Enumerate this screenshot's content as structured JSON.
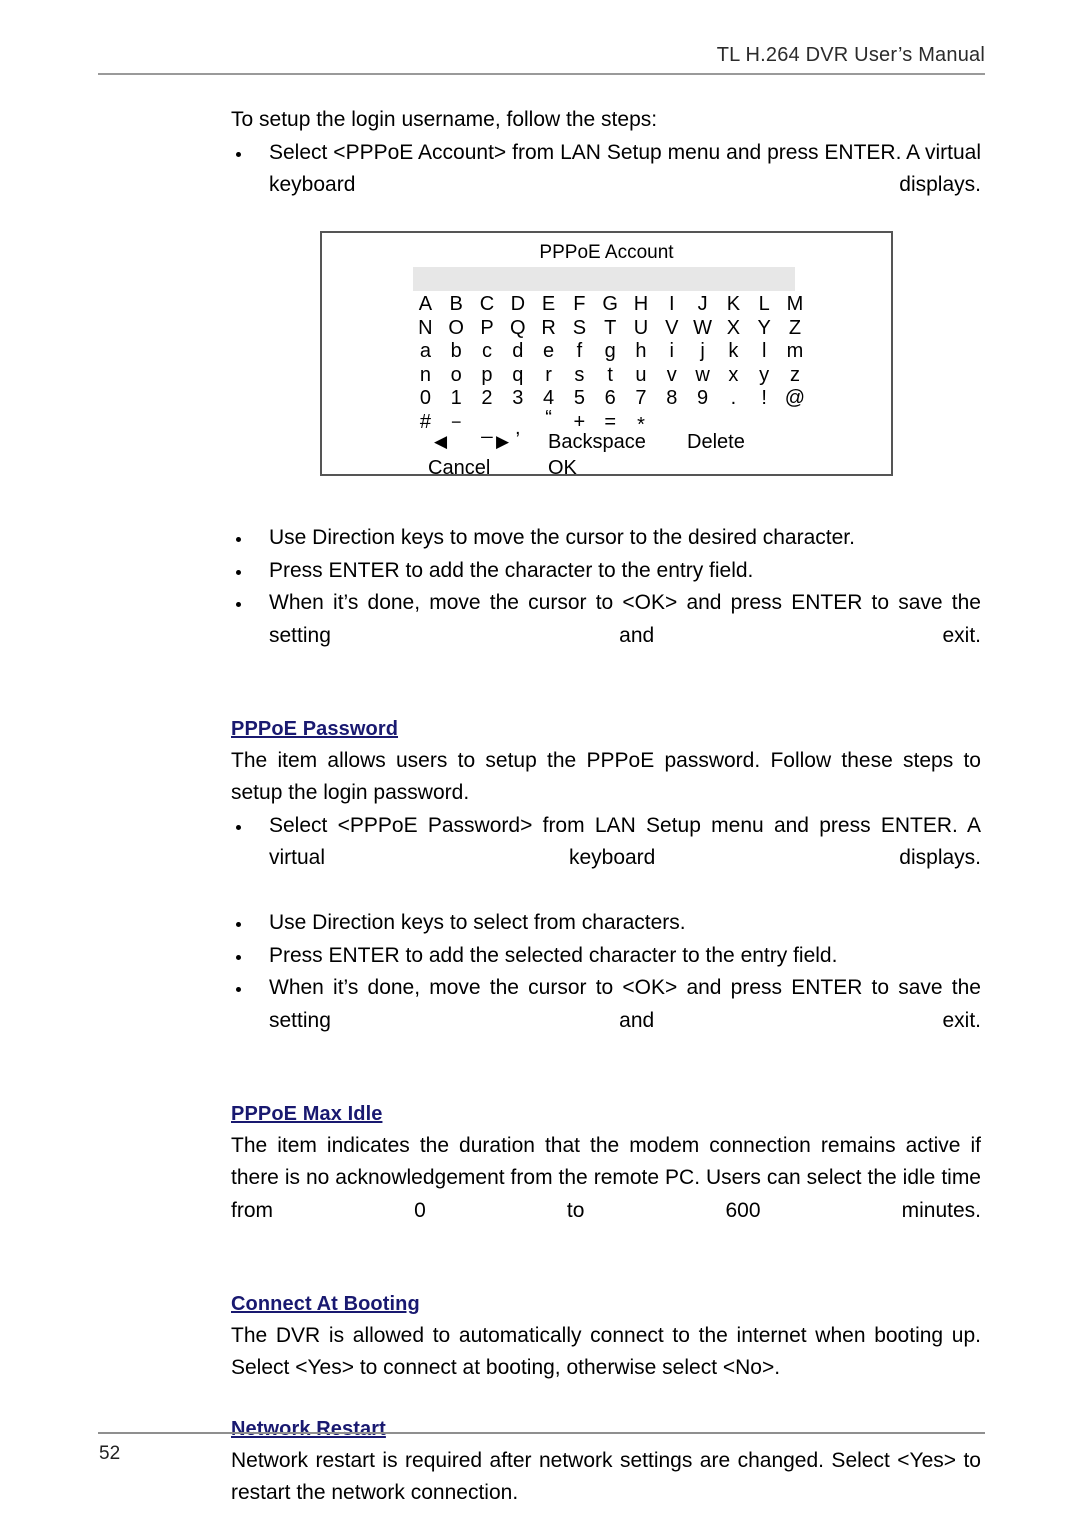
{
  "header": {
    "title": "TL H.264 DVR User’s Manual"
  },
  "intro": {
    "lead": "To setup the login username, follow the steps:",
    "bullets": [
      "Select <PPPoE Account> from LAN Setup menu and press ENTER. A virtual keyboard displays."
    ]
  },
  "keyboard": {
    "title": "PPPoE Account",
    "input_value": "",
    "rows": [
      [
        "A",
        "B",
        "C",
        "D",
        "E",
        "F",
        "G",
        "H",
        "I",
        "J",
        "K",
        "L",
        "M"
      ],
      [
        "N",
        "O",
        "P",
        "Q",
        "R",
        "S",
        "T",
        "U",
        "V",
        "W",
        "X",
        "Y",
        "Z"
      ],
      [
        "a",
        "b",
        "c",
        "d",
        "e",
        "f",
        "g",
        "h",
        "i",
        "j",
        "k",
        "l",
        "m"
      ],
      [
        "n",
        "o",
        "p",
        "q",
        "r",
        "s",
        "t",
        "u",
        "v",
        "w",
        "x",
        "y",
        "z"
      ],
      [
        "0",
        "1",
        "2",
        "3",
        "4",
        "5",
        "6",
        "7",
        "8",
        "9",
        ".",
        "!",
        "@"
      ],
      [
        "#",
        "−",
        "_",
        ",",
        "“",
        "+",
        "=",
        "*",
        "",
        "",
        "",
        "",
        ""
      ]
    ],
    "actions_row1": [
      "◀",
      "▶",
      "Backspace",
      "Delete"
    ],
    "actions_row2": [
      "Cancel",
      "OK"
    ]
  },
  "after_keyboard_bullets": [
    "Use Direction keys to move the cursor to the desired character.",
    "Press ENTER to add the character to the entry field.",
    "When it’s done, move the cursor to <OK> and press ENTER to save the setting and exit."
  ],
  "sections": [
    {
      "heading": "PPPoE Password",
      "paragraph": "The item allows users to setup the PPPoE password. Follow these steps to setup the login password.",
      "bullets": [
        "Select <PPPoE Password> from LAN Setup menu and press ENTER. A virtual keyboard displays.",
        "Use Direction keys to select from characters.",
        "Press ENTER to add the selected character to the entry field.",
        "When it’s done, move the cursor to <OK> and press ENTER to save the setting and exit."
      ]
    },
    {
      "heading": "PPPoE Max Idle",
      "paragraph": "The item indicates the duration that the modem connection remains active if there is no acknowledgement from the remote PC. Users can select the idle time from 0 to 600 minutes.",
      "bullets": []
    },
    {
      "heading": "Connect At Booting",
      "paragraph": "The DVR is allowed to automatically connect to the internet when booting up. Select <Yes> to connect at booting, otherwise select <No>.",
      "bullets": []
    },
    {
      "heading": "Network Restart",
      "paragraph": "Network restart is required after network settings are changed. Select <Yes> to restart the network connection.",
      "bullets": []
    }
  ],
  "footer": {
    "page_number": "52"
  },
  "colors": {
    "heading": "#191970",
    "rule": "#9a9a9a",
    "input_field": "#e7e7e7"
  }
}
